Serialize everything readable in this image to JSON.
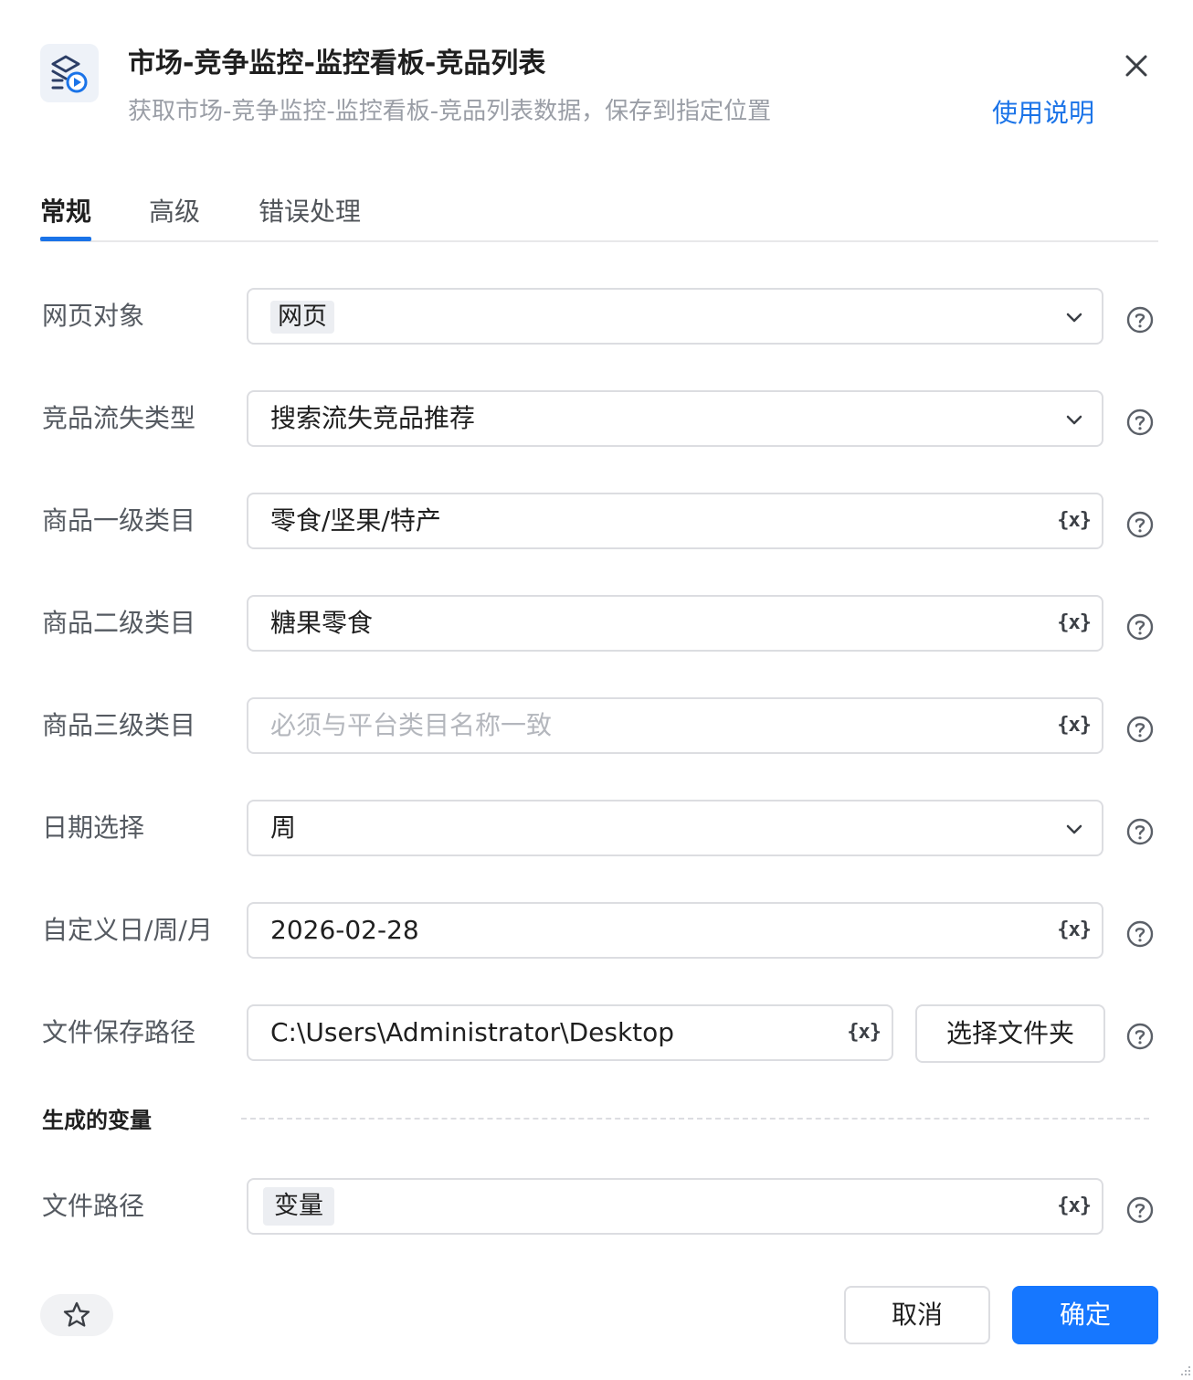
{
  "header": {
    "title": "市场-竞争监控-监控看板-竞品列表",
    "subtitle": "获取市场-竞争监控-监控看板-竞品列表数据，保存到指定位置",
    "help_link": "使用说明",
    "icon": "browser-automation-icon"
  },
  "tabs": [
    {
      "label": "常规",
      "active": true
    },
    {
      "label": "高级",
      "active": false
    },
    {
      "label": "错误处理",
      "active": false
    }
  ],
  "fields": {
    "web_object": {
      "label": "网页对象",
      "value": "网页"
    },
    "loss_type": {
      "label": "竞品流失类型",
      "value": "搜索流失竞品推荐"
    },
    "category_l1": {
      "label": "商品一级类目",
      "value": "零食/坚果/特产"
    },
    "category_l2": {
      "label": "商品二级类目",
      "value": "糖果零食"
    },
    "category_l3": {
      "label": "商品三级类目",
      "value": "",
      "placeholder": "必须与平台类目名称一致"
    },
    "date_select": {
      "label": "日期选择",
      "value": "周"
    },
    "custom_date": {
      "label": "自定义日/周/月",
      "value": "2026-02-28"
    },
    "save_path": {
      "label": "文件保存路径",
      "value": "C:\\Users\\Administrator\\Desktop",
      "button": "选择文件夹"
    }
  },
  "variable_button": "{x}",
  "generated": {
    "section_title": "生成的变量",
    "file_path": {
      "label": "文件路径",
      "value": "变量"
    }
  },
  "footer": {
    "cancel": "取消",
    "confirm": "确定"
  },
  "colors": {
    "accent": "#1677ff",
    "link": "#1a73e8"
  }
}
